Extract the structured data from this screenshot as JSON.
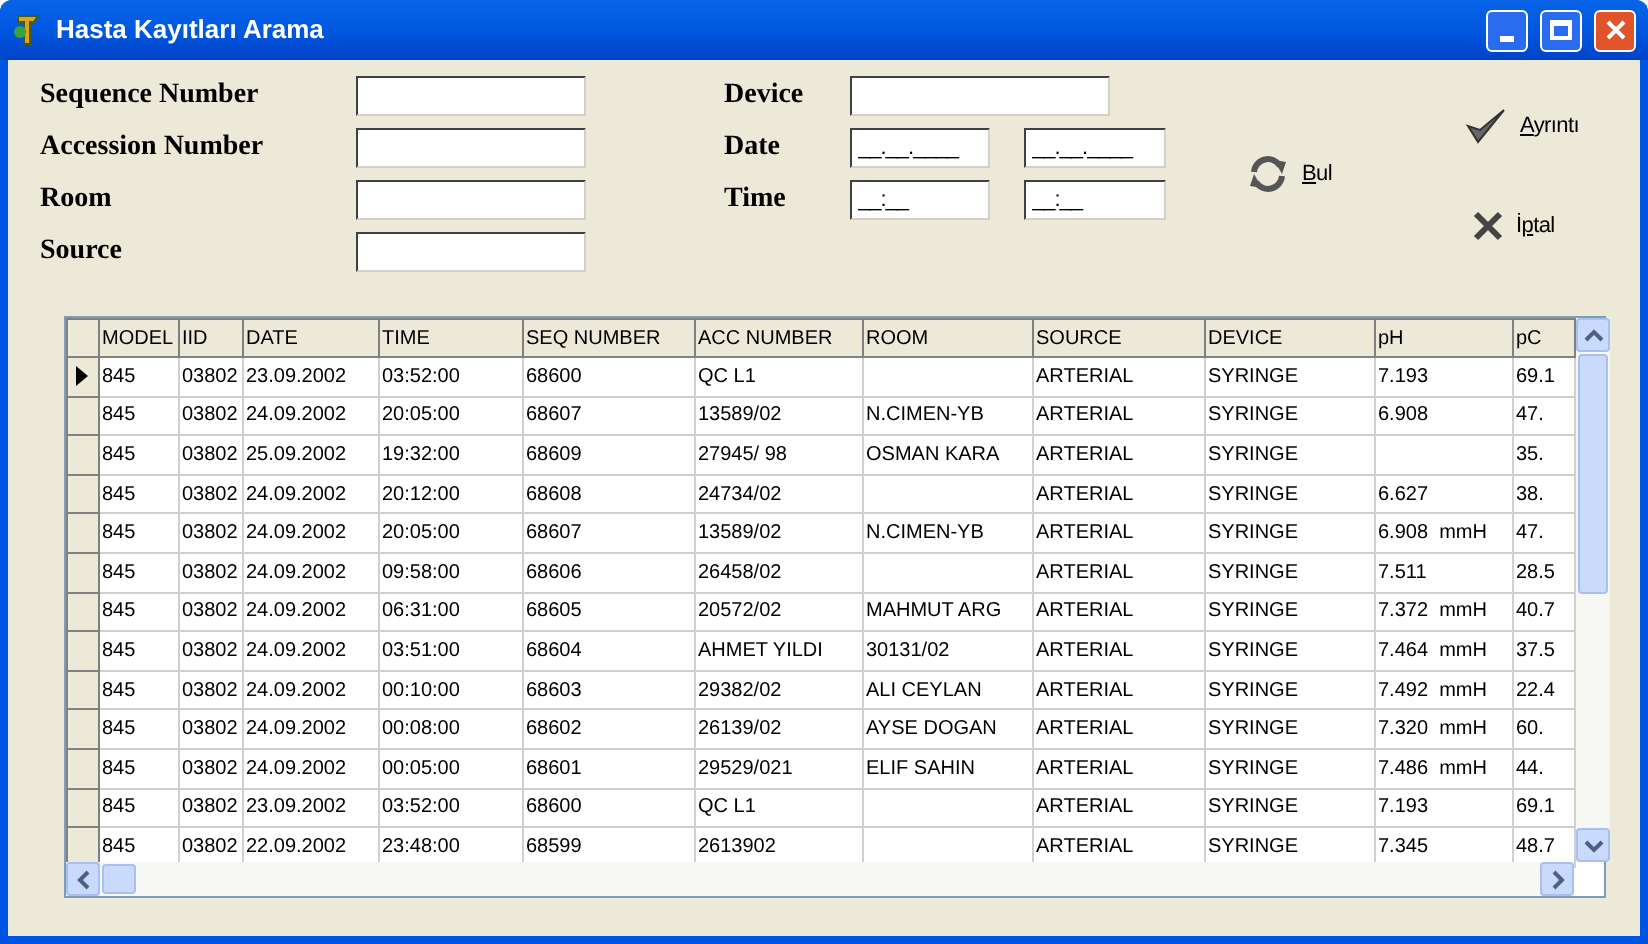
{
  "window": {
    "title": "Hasta Kayıtları Arama"
  },
  "form": {
    "left_fields": [
      {
        "label": "Sequence Number"
      },
      {
        "label": "Accession Number"
      },
      {
        "label": "Room"
      },
      {
        "label": "Source"
      }
    ],
    "device": {
      "label": "Device"
    },
    "date": {
      "label": "Date",
      "from": "__.__.____",
      "to": "__.__.____"
    },
    "time": {
      "label": "Time",
      "from": "__:__",
      "to": "__:__"
    }
  },
  "buttons": [
    {
      "kind": "search",
      "key": "B",
      "post": "ul"
    },
    {
      "kind": "details",
      "key": "A",
      "post": "yrıntı"
    },
    {
      "kind": "cancel",
      "pre": "İ",
      "key": "p",
      "post": "tal"
    }
  ],
  "table": {
    "columns": [
      "MODEL",
      "IID",
      "DATE",
      "TIME",
      "SEQ NUMBER",
      "ACC NUMBER",
      "ROOM",
      "SOURCE",
      "DEVICE",
      "pH",
      "pC"
    ],
    "rows": [
      {
        "selected": true,
        "cells": [
          "845",
          "03802",
          "23.09.2002",
          "03:52:00",
          "68600",
          "QC L1",
          null,
          "ARTERIAL",
          "SYRINGE",
          "7.193",
          "69.1"
        ]
      },
      {
        "selected": false,
        "cells": [
          "845",
          "03802",
          "24.09.2002",
          "20:05:00",
          "68607",
          "13589/02",
          "N.CIMEN-YB",
          "ARTERIAL",
          "SYRINGE",
          "6.908",
          "47."
        ]
      },
      {
        "selected": false,
        "cells": [
          "845",
          "03802",
          "25.09.2002",
          "19:32:00",
          "68609",
          "27945/ 98",
          "OSMAN KARA",
          "ARTERIAL",
          "SYRINGE",
          null,
          "35."
        ]
      },
      {
        "selected": false,
        "cells": [
          "845",
          "03802",
          "24.09.2002",
          "20:12:00",
          "68608",
          "24734/02",
          null,
          "ARTERIAL",
          "SYRINGE",
          "6.627",
          "38."
        ]
      },
      {
        "selected": false,
        "cells": [
          "845",
          "03802",
          "24.09.2002",
          "20:05:00",
          "68607",
          "13589/02",
          "N.CIMEN-YB",
          "ARTERIAL",
          "SYRINGE",
          "6.908  mmH",
          "47."
        ]
      },
      {
        "selected": false,
        "cells": [
          "845",
          "03802",
          "24.09.2002",
          "09:58:00",
          "68606",
          "26458/02",
          null,
          "ARTERIAL",
          "SYRINGE",
          "7.511",
          "28.5"
        ]
      },
      {
        "selected": false,
        "cells": [
          "845",
          "03802",
          "24.09.2002",
          "06:31:00",
          "68605",
          "20572/02",
          "MAHMUT ARG",
          "ARTERIAL",
          "SYRINGE",
          "7.372  mmH",
          "40.7"
        ]
      },
      {
        "selected": false,
        "cells": [
          "845",
          "03802",
          "24.09.2002",
          "03:51:00",
          "68604",
          "AHMET YILDI",
          "30131/02",
          "ARTERIAL",
          "SYRINGE",
          "7.464  mmH",
          "37.5"
        ]
      },
      {
        "selected": false,
        "cells": [
          "845",
          "03802",
          "24.09.2002",
          "00:10:00",
          "68603",
          "29382/02",
          "ALI CEYLAN",
          "ARTERIAL",
          "SYRINGE",
          "7.492  mmH",
          "22.4"
        ]
      },
      {
        "selected": false,
        "cells": [
          "845",
          "03802",
          "24.09.2002",
          "00:08:00",
          "68602",
          "26139/02",
          "AYSE DOGAN",
          "ARTERIAL",
          "SYRINGE",
          "7.320  mmH",
          "60."
        ]
      },
      {
        "selected": false,
        "cells": [
          "845",
          "03802",
          "24.09.2002",
          "00:05:00",
          "68601",
          "29529/021",
          "ELIF SAHIN",
          "ARTERIAL",
          "SYRINGE",
          "7.486  mmH",
          "44."
        ]
      },
      {
        "selected": false,
        "cells": [
          "845",
          "03802",
          "23.09.2002",
          "03:52:00",
          "68600",
          "QC L1",
          null,
          "ARTERIAL",
          "SYRINGE",
          "7.193",
          "69.1"
        ]
      },
      {
        "selected": false,
        "cells": [
          "845",
          "03802",
          "22.09.2002",
          "23:48:00",
          "68599",
          "2613902",
          null,
          "ARTERIAL",
          "SYRINGE",
          "7.345",
          "48.7"
        ]
      }
    ]
  }
}
